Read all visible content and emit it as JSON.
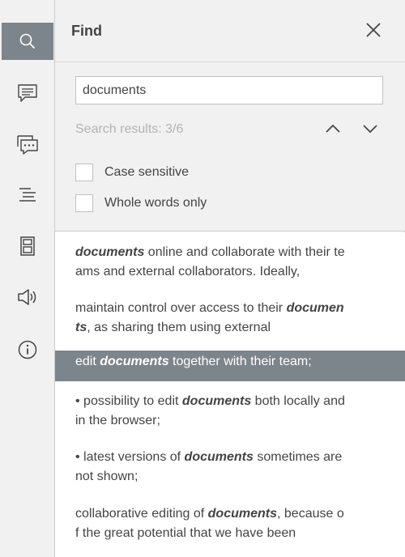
{
  "panel": {
    "title": "Find",
    "search": {
      "value": "documents",
      "placeholder": ""
    },
    "results_count": "Search results: 3/6",
    "options": [
      {
        "label": "Case sensitive",
        "checked": false
      },
      {
        "label": "Whole words only",
        "checked": false
      }
    ]
  },
  "toolbar": {
    "items": [
      {
        "icon": "search-icon",
        "active": true
      },
      {
        "icon": "comment-icon",
        "active": false
      },
      {
        "icon": "chat-icon",
        "active": false
      },
      {
        "icon": "headings-icon",
        "active": false
      },
      {
        "icon": "page-thumbnails-icon",
        "active": false
      },
      {
        "icon": "announcement-icon",
        "active": false
      },
      {
        "icon": "info-icon",
        "active": false
      }
    ]
  },
  "results": [
    {
      "lines": [
        {
          "before": "",
          "match": "documents",
          "after": " online and collaborate with their te"
        },
        {
          "before": "ams and external collaborators. Ideally,",
          "match": "",
          "after": ""
        }
      ],
      "selected": false
    },
    {
      "lines": [
        {
          "before": "maintain control over access to their ",
          "match": "documen",
          "after": ""
        },
        {
          "before": "",
          "match": "ts",
          "after": ", as sharing them using external"
        }
      ],
      "selected": false
    },
    {
      "lines": [
        {
          "before": "edit ",
          "match": "documents",
          "after": " together with their team;"
        }
      ],
      "selected": true
    },
    {
      "lines": [
        {
          "before": "• possibility to edit ",
          "match": "documents",
          "after": " both locally and"
        },
        {
          "before": "in the browser;",
          "match": "",
          "after": ""
        }
      ],
      "selected": false
    },
    {
      "lines": [
        {
          "before": "• latest versions of ",
          "match": "documents",
          "after": " sometimes are"
        },
        {
          "before": "not shown;",
          "match": "",
          "after": ""
        }
      ],
      "selected": false
    },
    {
      "lines": [
        {
          "before": "collaborative editing of ",
          "match": "documents",
          "after": ", because o"
        },
        {
          "before": "f the great potential that we have been",
          "match": "",
          "after": ""
        }
      ],
      "selected": false
    }
  ],
  "colors": {
    "accent": "#7d858c",
    "panel_bg": "#f1f1f1",
    "muted_text": "#b3b3b3"
  }
}
